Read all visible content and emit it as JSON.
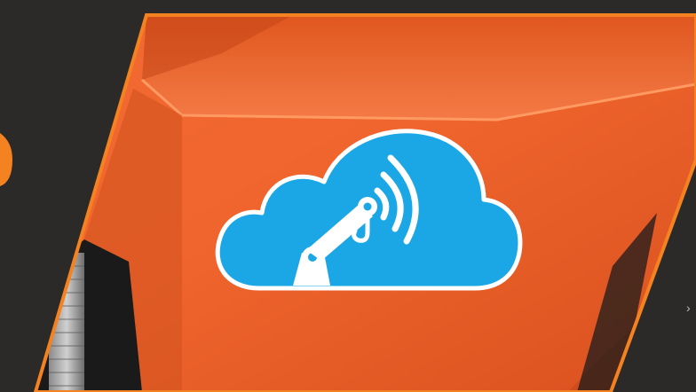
{
  "banner": {
    "background_color": "#2b2a28",
    "panel_color": "#f0652d",
    "panel_highlight": "#ff8a4f",
    "panel_shadow": "#c94a1a",
    "border_color": "#f58220",
    "left_badge_color": "#f58220",
    "cloud_color": "#1ba7e5",
    "cloud_outline_color": "#ffffff",
    "icon": "cloud-crane-signal-icon",
    "next_icon": "chevron-right-icon",
    "next_glyph": "›"
  }
}
